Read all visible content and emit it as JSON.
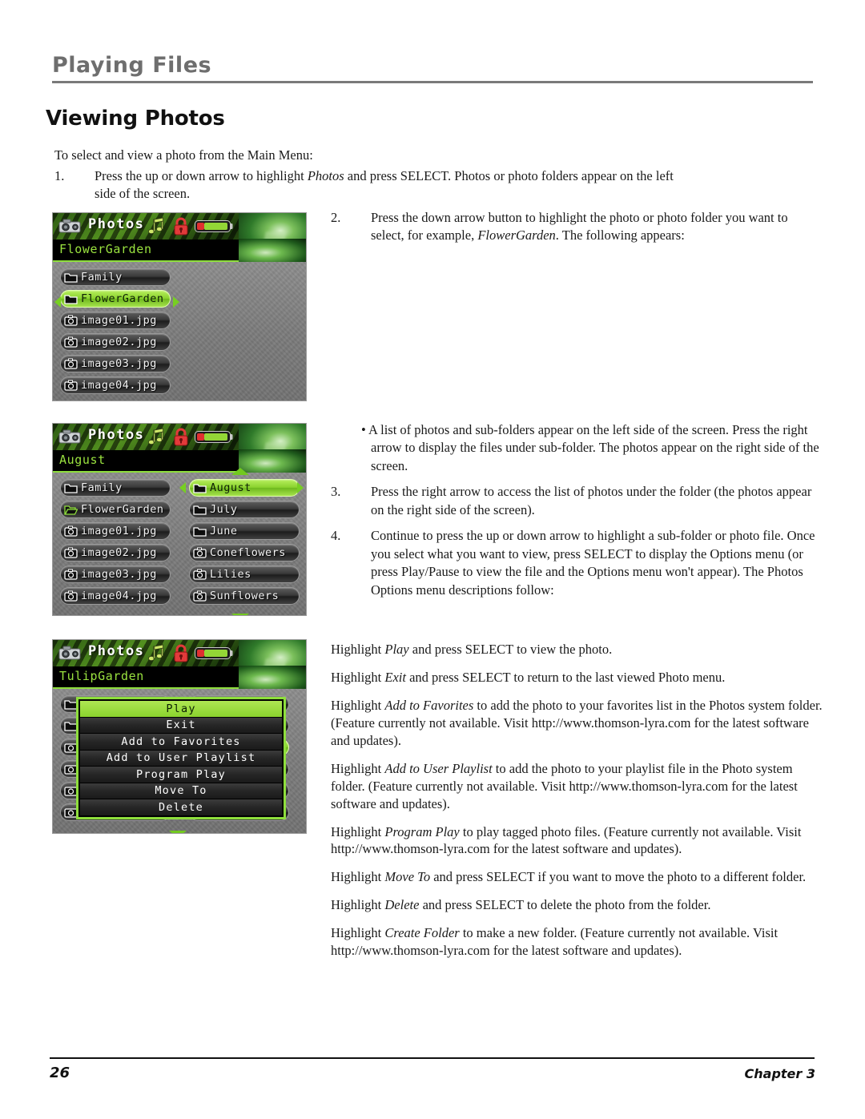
{
  "header": {
    "chapter_title": "Playing Files",
    "section_title": "Viewing Photos"
  },
  "intro": "To select and view a photo from the Main Menu:",
  "steps": {
    "step1_num": "1.",
    "step1_text_a": "Press the up or down arrow to highlight ",
    "step1_em": "Photos",
    "step1_text_b": " and press SELECT. Photos or photo folders appear on the left side of the screen.",
    "step2_num": "2.",
    "step2_text_a": "Press the down arrow button to highlight the photo or photo folder you want to select, for example, ",
    "step2_em": "FlowerGarden",
    "step2_text_b": ".  The following appears:",
    "bullet_text": "• A list of photos and sub-folders appear on the left side of the screen. Press the right arrow to display the files under sub-folder. The photos appear on the right side of the screen.",
    "step3_num": "3.",
    "step3_text": "Press the right arrow to access the list of photos under the folder (the photos appear on the right side of the screen).",
    "step4_num": "4.",
    "step4_text": "Continue to press the up or down arrow to highlight a sub-folder or photo file. Once you select what you want to view, press SELECT to display the Options menu (or press Play/Pause to view the file and the Options menu won't appear). The Photos Options menu descriptions follow:"
  },
  "descriptions": [
    {
      "lead": "Highlight ",
      "em": "Play",
      "rest": " and press SELECT to view the photo."
    },
    {
      "lead": "Highlight ",
      "em": "Exit",
      "rest": " and press SELECT to return to the last viewed Photo menu."
    },
    {
      "lead": "Highlight ",
      "em": "Add to Favorites",
      "rest": " to add the photo to your favorites list in the Photos system folder. (Feature currently not available. Visit http://www.thomson-lyra.com for the latest software and updates)."
    },
    {
      "lead": "Highlight ",
      "em": "Add to User Playlist",
      "rest": " to add the photo to your playlist file in the Photo system folder. (Feature currently not available. Visit http://www.thomson-lyra.com for the latest software and updates)."
    },
    {
      "lead": "Highlight ",
      "em": "Program Play",
      "rest": " to play tagged photo files. (Feature currently not available. Visit http://www.thomson-lyra.com for the latest software and updates)."
    },
    {
      "lead": "Highlight ",
      "em": "Move To",
      "rest": " and press SELECT if you want to move the photo to a different folder."
    },
    {
      "lead": "Highlight ",
      "em": "Delete",
      "rest": " and press SELECT to delete the photo from the folder."
    },
    {
      "lead": "Highlight ",
      "em": "Create Folder",
      "rest": " to make a new folder. (Feature currently not available. Visit http://www.thomson-lyra.com for the latest software and updates)."
    }
  ],
  "device_screens": [
    {
      "id": "screen-flowergarden",
      "title": "Photos",
      "breadcrumb": "FlowerGarden",
      "icons": [
        "camera-icon",
        "music-notes-icon",
        "lock-icon",
        "battery-icon"
      ],
      "left_list": [
        {
          "label": "Family",
          "icon": "folder-icon",
          "selected": false
        },
        {
          "label": "FlowerGarden",
          "icon": "folder-icon",
          "selected": true
        },
        {
          "label": "image01.jpg",
          "icon": "photo-icon",
          "selected": false
        },
        {
          "label": "image02.jpg",
          "icon": "photo-icon",
          "selected": false
        },
        {
          "label": "image03.jpg",
          "icon": "photo-icon",
          "selected": false
        },
        {
          "label": "image04.jpg",
          "icon": "photo-icon",
          "selected": false
        }
      ],
      "right_list": []
    },
    {
      "id": "screen-august",
      "title": "Photos",
      "breadcrumb": "August",
      "icons": [
        "camera-icon",
        "music-notes-icon",
        "lock-icon",
        "battery-icon"
      ],
      "left_list": [
        {
          "label": "Family",
          "icon": "folder-icon",
          "selected": false
        },
        {
          "label": "FlowerGarden",
          "icon": "folder-open-icon",
          "selected": false
        },
        {
          "label": "image01.jpg",
          "icon": "photo-icon",
          "selected": false
        },
        {
          "label": "image02.jpg",
          "icon": "photo-icon",
          "selected": false
        },
        {
          "label": "image03.jpg",
          "icon": "photo-icon",
          "selected": false
        },
        {
          "label": "image04.jpg",
          "icon": "photo-icon",
          "selected": false
        }
      ],
      "right_list": [
        {
          "label": "August",
          "icon": "folder-icon",
          "selected": true
        },
        {
          "label": "July",
          "icon": "folder-icon",
          "selected": false
        },
        {
          "label": "June",
          "icon": "folder-icon",
          "selected": false
        },
        {
          "label": "Coneflowers",
          "icon": "photo-icon",
          "selected": false
        },
        {
          "label": "Lilies",
          "icon": "photo-icon",
          "selected": false
        },
        {
          "label": "Sunflowers",
          "icon": "photo-icon",
          "selected": false
        }
      ]
    },
    {
      "id": "screen-tulipgarden",
      "title": "Photos",
      "breadcrumb": "TulipGarden",
      "icons": [
        "camera-icon",
        "music-notes-icon",
        "lock-icon",
        "battery-icon"
      ],
      "options_menu": [
        {
          "label": "Play",
          "selected": true
        },
        {
          "label": "Exit",
          "selected": false
        },
        {
          "label": "Add to Favorites",
          "selected": false
        },
        {
          "label": "Add to User Playlist",
          "selected": false
        },
        {
          "label": "Program Play",
          "selected": false
        },
        {
          "label": "Move To",
          "selected": false
        },
        {
          "label": "Delete",
          "selected": false
        }
      ]
    }
  ],
  "footer": {
    "page_number": "26",
    "chapter_label": "Chapter 3"
  },
  "colors": {
    "accent_green": "#8ede3c",
    "header_gray": "#6e6e6e",
    "screen_black": "#000000"
  }
}
